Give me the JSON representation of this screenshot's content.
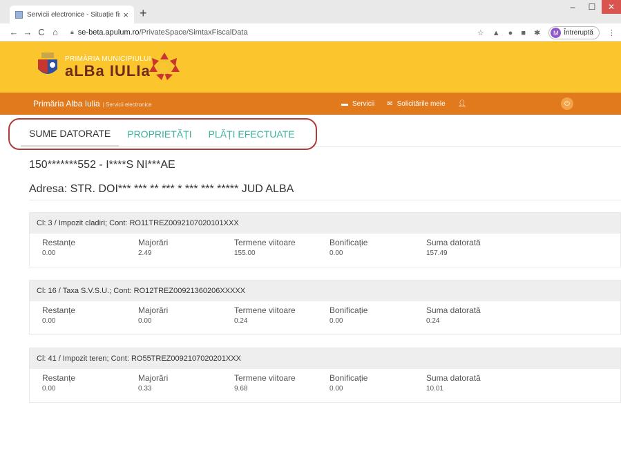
{
  "browser": {
    "tab_title": "Servicii electronice - Situație fisc",
    "tab_close": "×",
    "new_tab": "+",
    "url_host": "se-beta.apulum.ro",
    "url_path": "/PrivateSpace/SimtaxFiscalData",
    "profile_initial": "M",
    "profile_status": "Întreruptă"
  },
  "header": {
    "logo_small": "PRIMĂRIA MUNICIPIULUI",
    "logo_big": "aLBa IULIa"
  },
  "nav": {
    "home": "Primăria Alba Iulia",
    "home_sub": "| Servicii electronice",
    "servicii": "Servicii",
    "solicitari": "Solicitările mele"
  },
  "tabs": [
    "SUME DATORATE",
    "PROPRIETĂȚI",
    "PLĂȚI EFECTUATE"
  ],
  "person": {
    "id_line": "150*******552 - I****S NI***AE",
    "address": "Adresa: STR. DOI*** *** ** *** * *** *** ***** JUD ALBA"
  },
  "columns": [
    "Restanțe",
    "Majorări",
    "Termene viitoare",
    "Bonificație",
    "Suma datorată"
  ],
  "cards": [
    {
      "title": "Cl: 3 / Impozit cladiri; Cont: RO11TREZ0092107020101XXX",
      "values": [
        "0.00",
        "2.49",
        "155.00",
        "0.00",
        "157.49"
      ]
    },
    {
      "title": "Cl: 16 / Taxa S.V.S.U.; Cont: RO12TREZ00921360206XXXXX",
      "values": [
        "0.00",
        "0.00",
        "0.24",
        "0.00",
        "0.24"
      ]
    },
    {
      "title": "Cl: 41 / Impozit teren; Cont: RO55TREZ0092107020201XXX",
      "values": [
        "0.00",
        "0.33",
        "9.68",
        "0.00",
        "10.01"
      ]
    }
  ],
  "colors": {
    "brand_yellow": "#fbc52d",
    "nav_orange": "#e07a1d",
    "tab_green": "#38b29d",
    "highlight_red": "#b03a3a"
  }
}
